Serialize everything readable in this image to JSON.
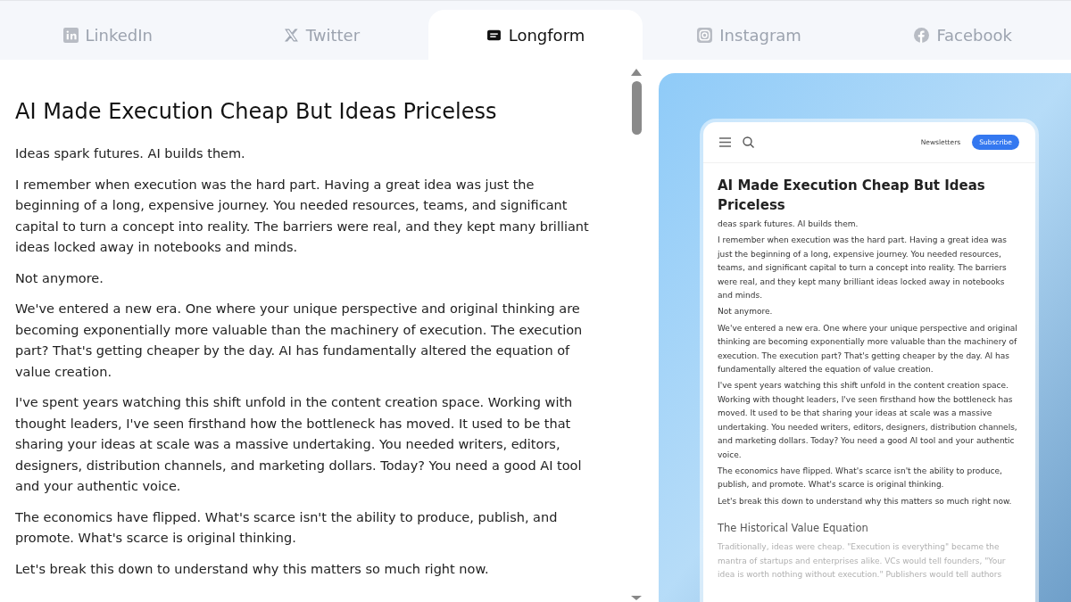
{
  "tabs": [
    {
      "label": "LinkedIn",
      "kind": "linkedin",
      "selected": false
    },
    {
      "label": "Twitter",
      "kind": "x",
      "selected": false
    },
    {
      "label": "Longform",
      "kind": "longform",
      "selected": true
    },
    {
      "label": "Instagram",
      "kind": "instagram",
      "selected": false
    },
    {
      "label": "Facebook",
      "kind": "facebook",
      "selected": false
    }
  ],
  "editor": {
    "title": "AI Made Execution Cheap But Ideas Priceless",
    "paragraphs": [
      "Ideas spark futures. AI builds them.",
      "I remember when execution was the hard part. Having a great idea was just the beginning of a long, expensive journey. You needed resources, teams, and significant capital to turn a concept into reality. The barriers were real, and they kept many brilliant ideas locked away in notebooks and minds.",
      "Not anymore.",
      "We've entered a new era. One where your unique perspective and original thinking are becoming exponentially more valuable than the machinery of execution. The execution part? That's getting cheaper by the day. AI has fundamentally altered the equation of value creation.",
      "I've spent years watching this shift unfold in the content creation space. Working with thought leaders, I've seen firsthand how the bottleneck has moved. It used to be that sharing your ideas at scale was a massive undertaking. You needed writers, editors, designers, distribution channels, and marketing dollars. Today? You need a good AI tool and your authentic voice.",
      "The economics have flipped. What's scarce isn't the ability to produce, publish, and promote. What's scarce is original thinking.",
      "Let's break this down to understand why this matters so much right now."
    ]
  },
  "preview": {
    "nav_link": "Newsletters",
    "subscribe": "Subscribe",
    "title": "AI Made Execution Cheap But Ideas Priceless",
    "paragraphs": [
      "deas spark futures. AI builds them.",
      "I remember when execution was the hard part. Having a great idea was just the beginning of a long, expensive journey. You needed resources, teams, and significant capital to turn a concept into reality. The barriers were real, and they kept many brilliant ideas locked away in notebooks and minds.",
      "Not anymore.",
      "We've entered a new era. One where your unique perspective and original thinking are becoming exponentially more valuable than the machinery of execution. The execution part? That's getting cheaper by the day. AI has fundamentally altered the equation of value creation.",
      "I've spent years watching this shift unfold in the content creation space. Working with thought leaders, I've seen firsthand how the bottleneck has moved. It used to be that sharing your ideas at scale was a massive undertaking. You needed writers, editors, designers, distribution channels, and marketing dollars. Today? You need a good AI tool and your authentic voice.",
      "The economics have flipped. What's scarce isn't the ability to produce, publish, and promote. What's scarce is original thinking.",
      "Let's break this down to understand why this matters so much right now."
    ],
    "subheading": "The Historical Value Equation",
    "faded_paragraph": "Traditionally, ideas were cheap. \"Execution is everything\" became the mantra of startups and enterprises alike. VCs would tell founders, \"Your idea is worth nothing without execution.\" Publishers would tell authors"
  }
}
